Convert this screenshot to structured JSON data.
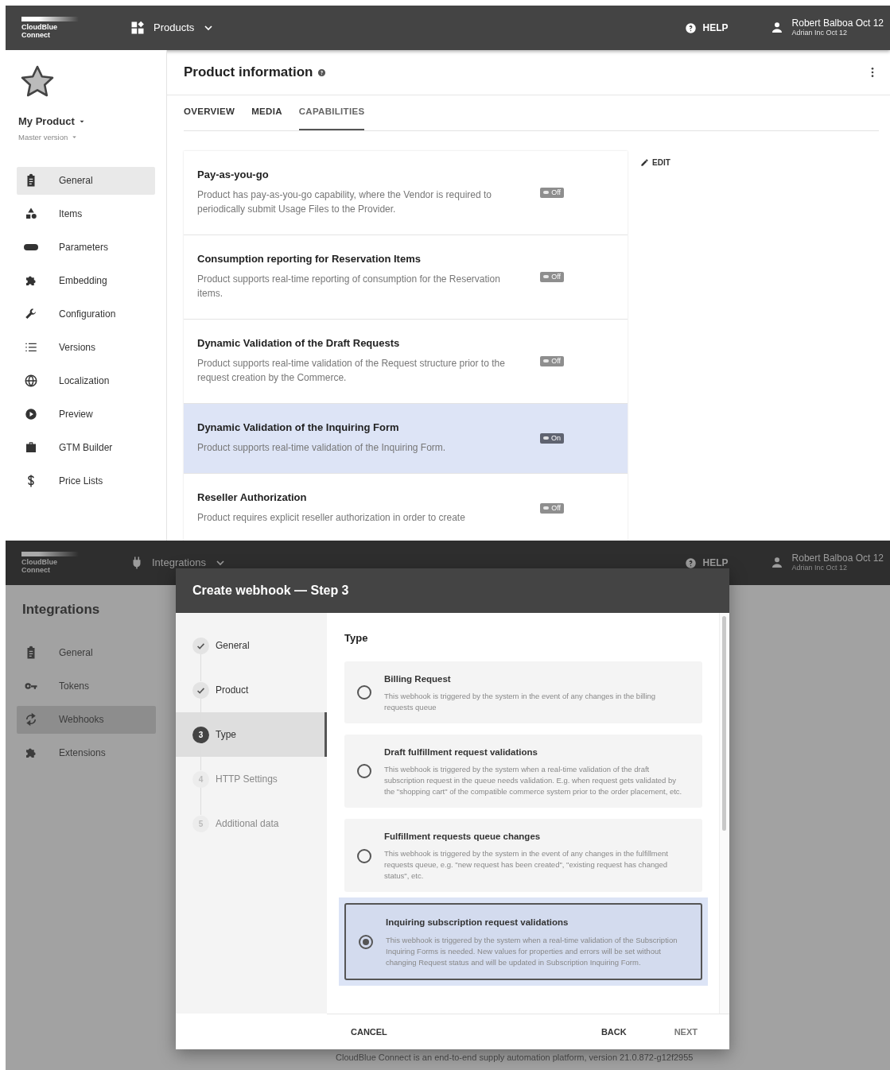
{
  "product_screen": {
    "header": {
      "logo": "CloudBlue Connect",
      "module": "Products",
      "help": "HELP",
      "user_name": "Robert Balboa Oct 12",
      "account": "Adrian Inc Oct 12"
    },
    "product": {
      "name": "My Product",
      "version": "Master version"
    },
    "sidebar": {
      "items": [
        {
          "label": "General",
          "selected": true
        },
        {
          "label": "Items",
          "selected": false
        },
        {
          "label": "Parameters",
          "selected": false
        },
        {
          "label": "Embedding",
          "selected": false
        },
        {
          "label": "Configuration",
          "selected": false
        },
        {
          "label": "Versions",
          "selected": false
        },
        {
          "label": "Localization",
          "selected": false
        },
        {
          "label": "Preview",
          "selected": false
        },
        {
          "label": "GTM Builder",
          "selected": false
        },
        {
          "label": "Price Lists",
          "selected": false
        }
      ]
    },
    "page_title": "Product information",
    "tabs": [
      {
        "label": "OVERVIEW",
        "selected": false
      },
      {
        "label": "MEDIA",
        "selected": false
      },
      {
        "label": "CAPABILITIES",
        "selected": true
      }
    ],
    "edit_button": "EDIT",
    "capabilities": [
      {
        "title": "Pay-as-you-go",
        "description": "Product has pay-as-you-go capability, where the Vendor is required to periodically submit Usage Files to the Provider.",
        "toggle_label": "Off",
        "on": false,
        "highlighted": false
      },
      {
        "title": "Consumption reporting for Reservation Items",
        "description": "Product supports real-time reporting of consumption for the Reservation items.",
        "toggle_label": "Off",
        "on": false,
        "highlighted": false
      },
      {
        "title": "Dynamic Validation of the Draft Requests",
        "description": "Product supports real-time validation of the Request structure prior to the request creation by the Commerce.",
        "toggle_label": "Off",
        "on": false,
        "highlighted": false
      },
      {
        "title": "Dynamic Validation of the Inquiring Form",
        "description": "Product supports real-time validation of the Inquiring Form.",
        "toggle_label": "On",
        "on": true,
        "highlighted": true
      },
      {
        "title": "Reseller Authorization",
        "description": "Product requires explicit reseller authorization in order to create",
        "toggle_label": "Off",
        "on": false,
        "highlighted": false
      }
    ]
  },
  "integrations_screen": {
    "header": {
      "logo": "CloudBlue Connect",
      "module": "Integrations",
      "help": "HELP",
      "user_name": "Robert Balboa Oct 12",
      "account": "Adrian Inc Oct 12"
    },
    "sidebar": {
      "title": "Integrations",
      "items": [
        {
          "label": "General",
          "selected": false
        },
        {
          "label": "Tokens",
          "selected": false
        },
        {
          "label": "Webhooks",
          "selected": true
        },
        {
          "label": "Extensions",
          "selected": false
        }
      ]
    },
    "footer_text": "CloudBlue Connect is an end-to-end supply automation platform, version 21.0.872-g12f2955",
    "modal": {
      "title": "Create webhook — Step 3",
      "steps": [
        {
          "label": "General",
          "done": true,
          "current": false
        },
        {
          "label": "Product",
          "done": true,
          "current": false
        },
        {
          "number": "3",
          "label": "Type",
          "done": false,
          "current": true
        },
        {
          "number": "4",
          "label": "HTTP Settings",
          "done": false,
          "current": false
        },
        {
          "number": "5",
          "label": "Additional data",
          "done": false,
          "current": false
        }
      ],
      "section_title": "Type",
      "options": [
        {
          "title": "Billing Request",
          "description": "This webhook is triggered by the system in the event of any changes in the billing requests queue",
          "selected": false
        },
        {
          "title": "Draft fulfillment request validations",
          "description": "This webhook is triggered by the system when a real-time validation of the draft subscription request in the queue needs validation. E.g. when request gets validated by the \"shopping cart\" of the compatible commerce system prior to the order placement, etc.",
          "selected": false
        },
        {
          "title": "Fulfillment requests queue changes",
          "description": "This webhook is triggered by the system in the event of any changes in the fulfillment requests queue, e.g. \"new request has been created\", \"existing request has changed status\", etc.",
          "selected": false
        },
        {
          "title": "Inquiring subscription request validations",
          "description": "This webhook is triggered by the system when a real-time validation of the Subscription Inquiring Forms is needed. New values for properties and errors will be set without changing Request status and will be updated in Subscription Inquiring Form.",
          "selected": true
        }
      ],
      "cancel_button": "CANCEL",
      "actions": [
        {
          "label": "BACK",
          "disabled": false
        },
        {
          "label": "NEXT",
          "disabled": true
        }
      ]
    }
  }
}
